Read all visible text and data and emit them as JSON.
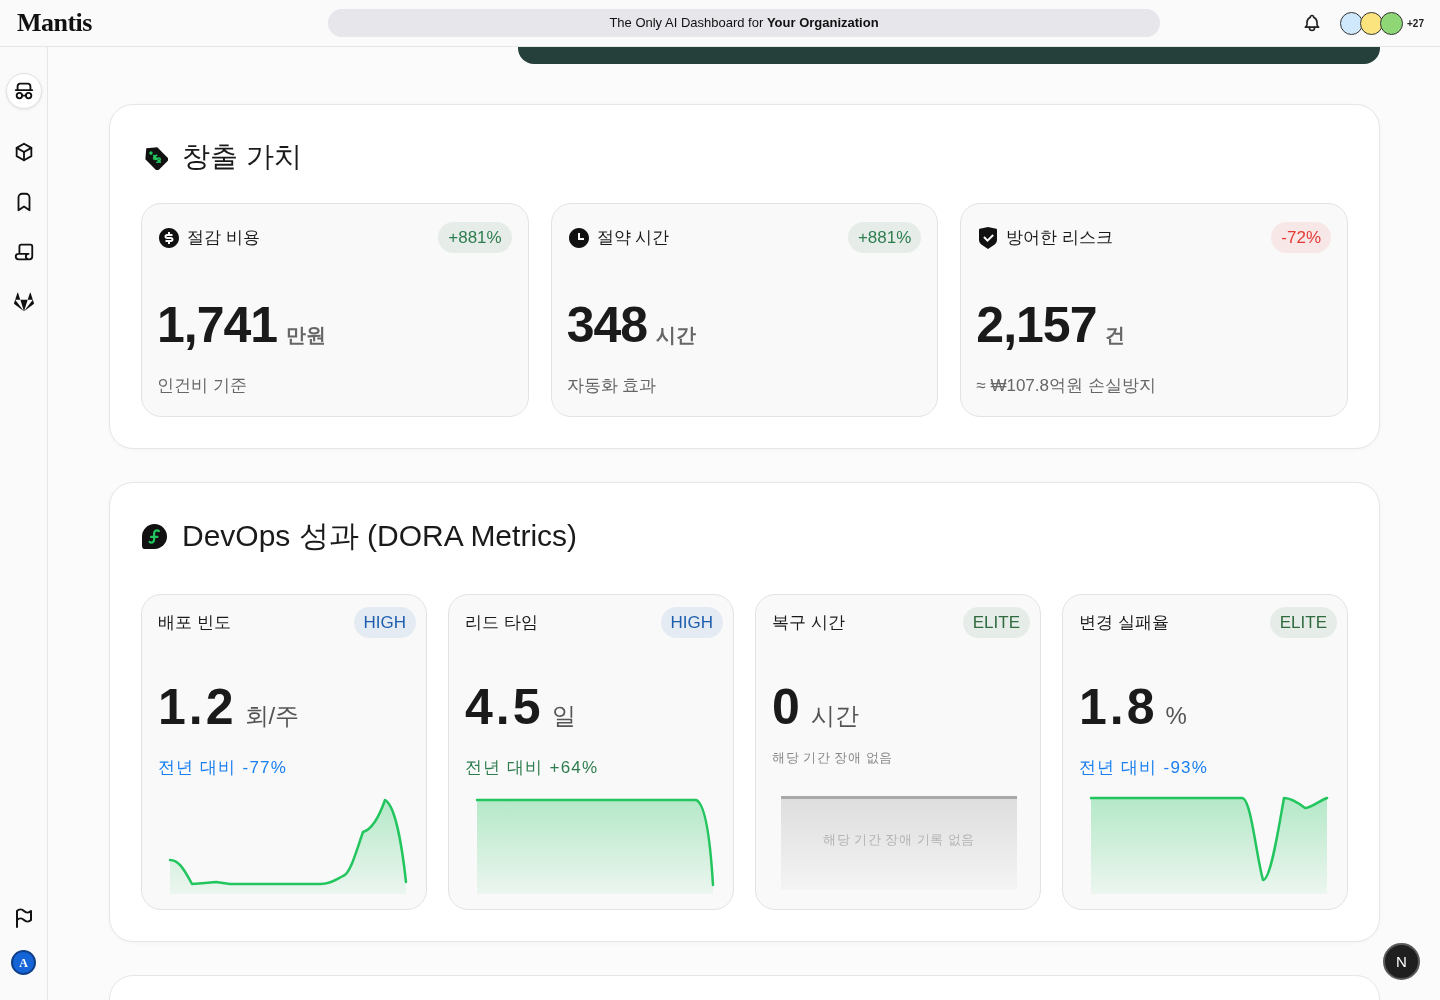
{
  "top_bar": {
    "logo": "Mantis",
    "tagline": "The Only AI Dashboard for **Your Organization**",
    "avatars": [
      {
        "color": "#cfe8fb"
      },
      {
        "color": "#fbe47e"
      },
      {
        "color": "#8fd776"
      }
    ],
    "avatar_overflow": "+27"
  },
  "sidebar": {
    "items": [
      {
        "selected": true
      },
      {
        "selected": false
      },
      {
        "selected": false
      },
      {
        "selected": false
      },
      {
        "selected": false
      }
    ],
    "user_initial": "A"
  },
  "value_section": {
    "title": "창출 가치",
    "cards": [
      {
        "label": "절감 비용",
        "badge": {
          "text": "+881%",
          "color": "#2e7d4f"
        },
        "value": "1,741",
        "unit": "만원",
        "caption": "인건비 기준"
      },
      {
        "label": "절약 시간",
        "badge": {
          "text": "+881%",
          "color": "#2e7d4f"
        },
        "value": "348",
        "unit": "시간",
        "caption": "자동화 효과"
      },
      {
        "label": "방어한 리스크",
        "badge": {
          "text": "-72%",
          "color": "#e53935"
        },
        "value": "2,157",
        "unit": "건",
        "caption": "≈ ₩107.8억원 손실방지"
      }
    ]
  },
  "dora_section": {
    "title": "DevOps 성과 (DORA Metrics)",
    "cards": [
      {
        "label": "배포 빈도",
        "badge": {
          "text": "HIGH",
          "color": "#1d5fae"
        },
        "value": "1.2",
        "unit": "회/주",
        "change": {
          "text": "전년 대비 -77%",
          "color": "#1a7ff0"
        },
        "chart": {
          "kind": "sparkline"
        }
      },
      {
        "label": "리드 타임",
        "badge": {
          "text": "HIGH",
          "color": "#1d5fae"
        },
        "value": "4.5",
        "unit": "일",
        "change": {
          "text": "전년 대비 +64%",
          "color": "#2e7d4f"
        },
        "chart": {
          "kind": "sparkline"
        }
      },
      {
        "label": "복구 시간",
        "badge": {
          "text": "ELITE",
          "color": "#2f6b3f"
        },
        "value": "0",
        "unit": "시간",
        "note": "해당 기간 장애 없음",
        "chart": {
          "kind": "empty",
          "text": "해당 기간 장애 기록 없음"
        }
      },
      {
        "label": "변경 실패율",
        "badge": {
          "text": "ELITE",
          "color": "#2f6b3f"
        },
        "value": "1.8",
        "unit": "%",
        "change": {
          "text": "전년 대비 -93%",
          "color": "#1a7ff0"
        },
        "chart": {
          "kind": "sparkline"
        }
      }
    ]
  },
  "floating_button": {
    "label": "N"
  }
}
